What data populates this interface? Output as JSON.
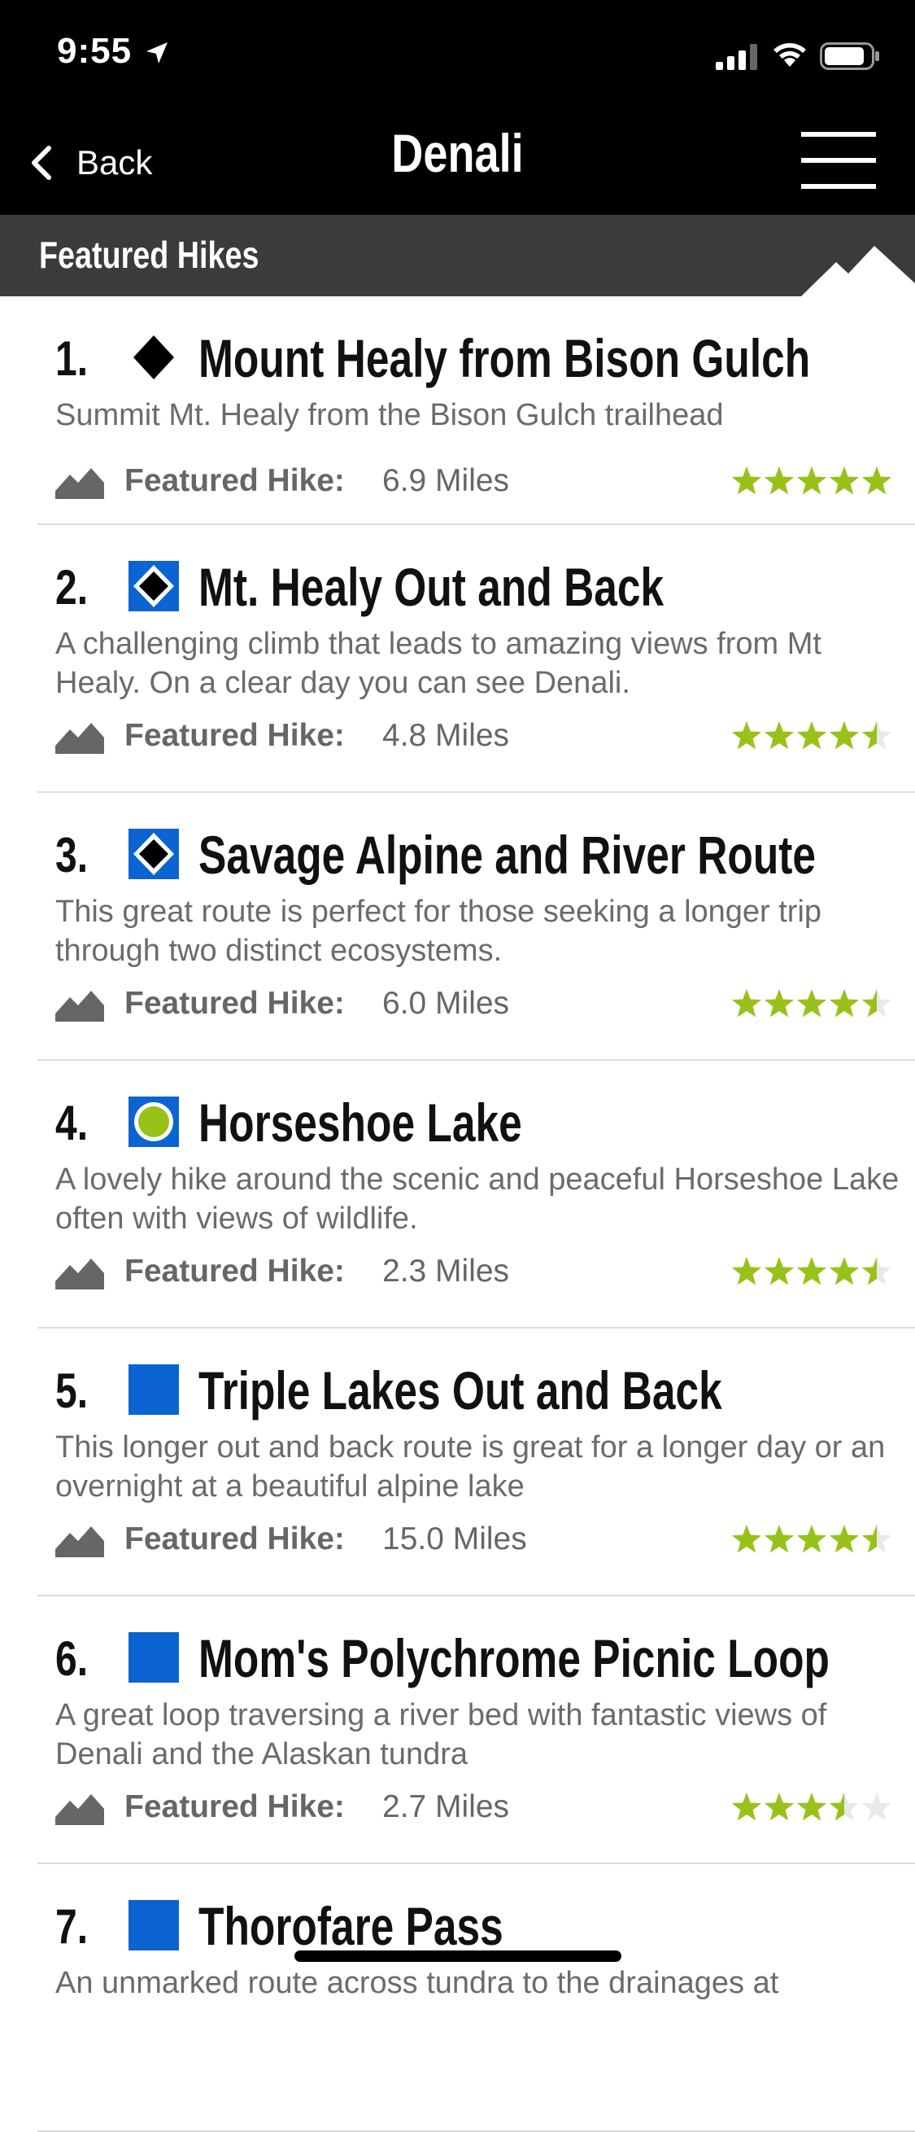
{
  "status": {
    "time": "9:55"
  },
  "nav": {
    "back_label": "Back",
    "title": "Denali"
  },
  "section": {
    "title": "Featured Hikes"
  },
  "colors": {
    "accent_green": "#98c11a",
    "difficulty_blue": "#0b64d1",
    "header_bg": "#3b3b3b"
  },
  "hikes": [
    {
      "number": "1.",
      "difficulty": "black-diamond",
      "name": "Mount Healy from Bison Gulch",
      "description": "Summit Mt. Healy from the Bison Gulch trailhead",
      "featured_label": "Featured Hike:",
      "distance": "6.9 Miles",
      "rating": 5
    },
    {
      "number": "2.",
      "difficulty": "blue-black",
      "name": "Mt. Healy Out and Back",
      "description": "A challenging climb that leads to amazing views from Mt Healy. On a clear day you can see Denali.",
      "featured_label": "Featured Hike:",
      "distance": "4.8 Miles",
      "rating": 4.5
    },
    {
      "number": "3.",
      "difficulty": "blue-black",
      "name": "Savage Alpine and River Route",
      "description": "This great route is perfect for those seeking a longer trip through two distinct ecosystems.",
      "featured_label": "Featured Hike:",
      "distance": "6.0 Miles",
      "rating": 4.5
    },
    {
      "number": "4.",
      "difficulty": "green-blue",
      "name": "Horseshoe Lake",
      "description": "A lovely hike around the scenic and peaceful Horseshoe Lake often with views of wildlife.",
      "featured_label": "Featured Hike:",
      "distance": "2.3 Miles",
      "rating": 4.5
    },
    {
      "number": "5.",
      "difficulty": "blue",
      "name": "Triple Lakes Out and Back",
      "description": "This longer out and back route is great for a longer day or an overnight at a beautiful alpine lake",
      "featured_label": "Featured Hike:",
      "distance": "15.0 Miles",
      "rating": 4.5
    },
    {
      "number": "6.",
      "difficulty": "blue",
      "name": "Mom's Polychrome Picnic Loop",
      "description": "A great loop traversing a river bed with fantastic views of Denali and the Alaskan tundra",
      "featured_label": "Featured Hike:",
      "distance": "2.7 Miles",
      "rating": 3.5
    },
    {
      "number": "7.",
      "difficulty": "blue",
      "name": "Thorofare Pass",
      "description": "An unmarked route across tundra to the drainages at",
      "featured_label": "",
      "distance": "",
      "rating": 0
    }
  ]
}
